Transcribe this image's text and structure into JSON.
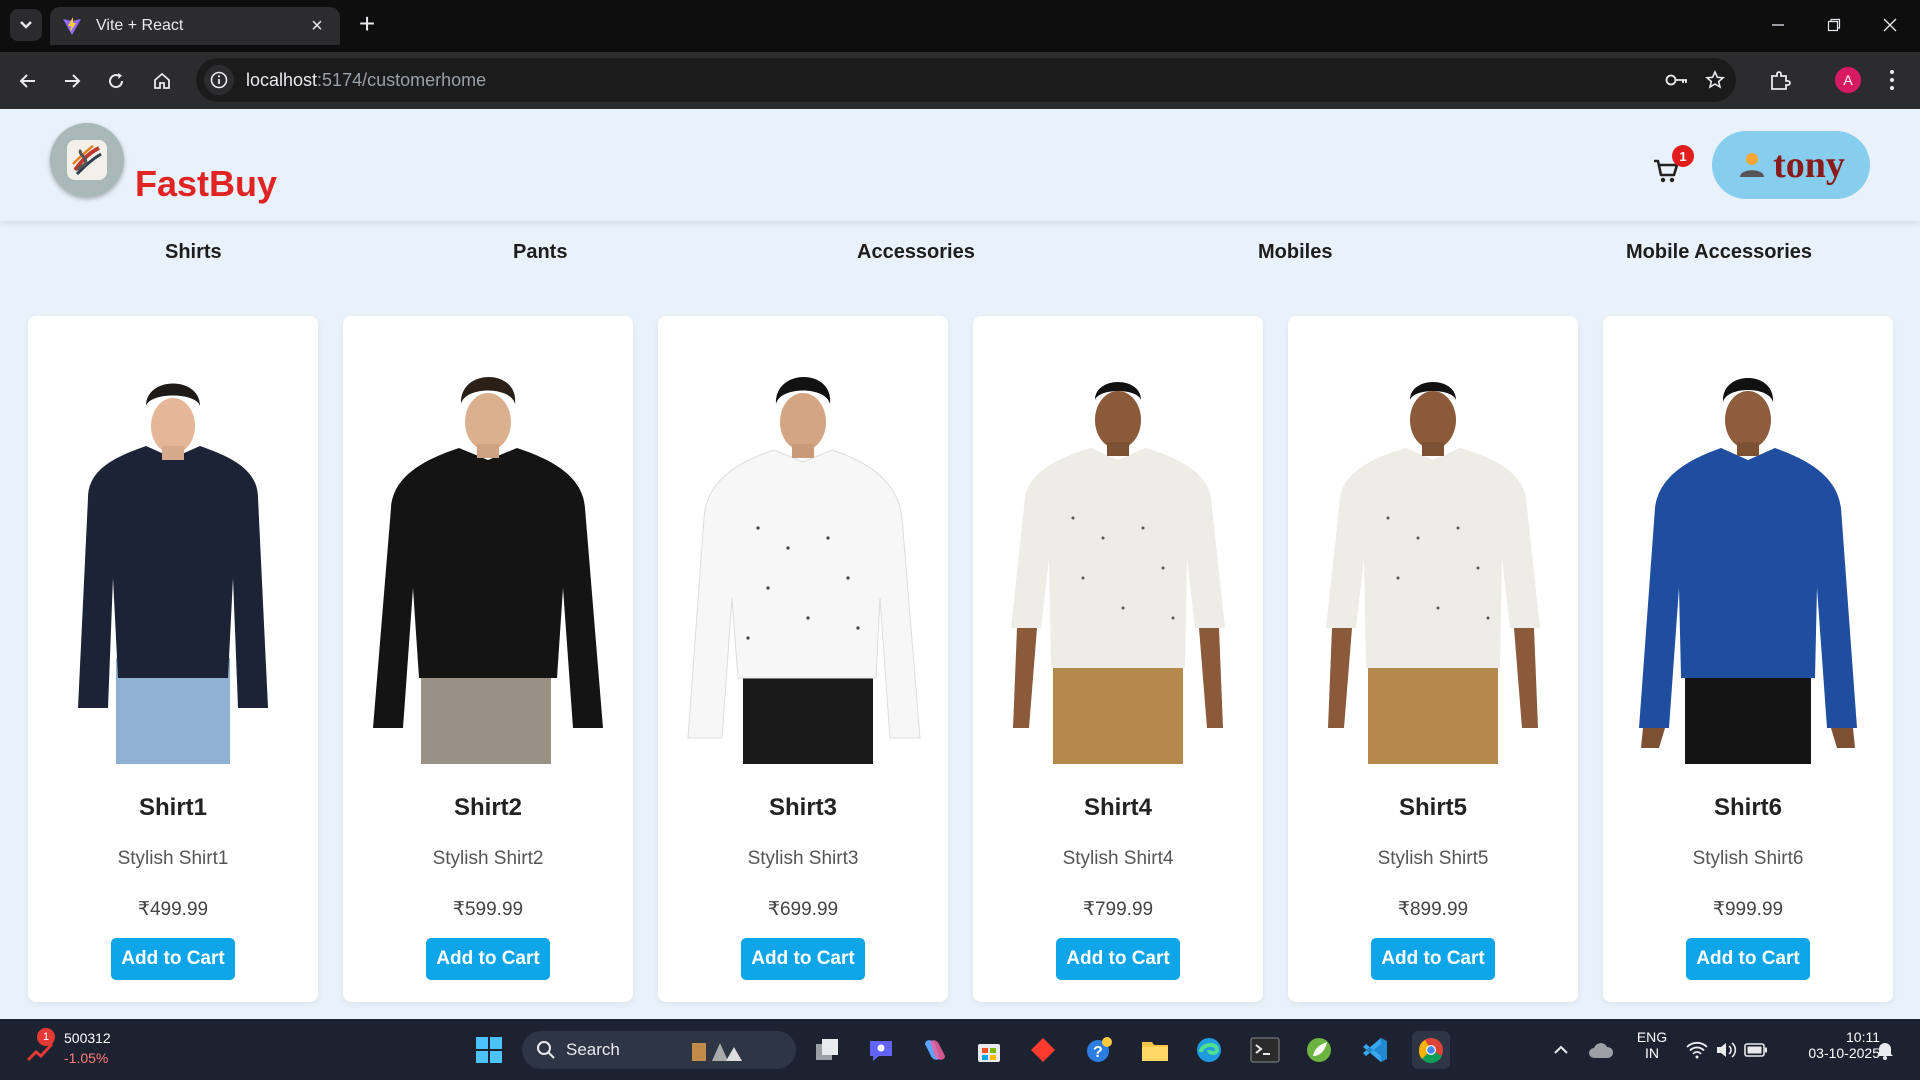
{
  "browser": {
    "tab_title": "Vite + React",
    "new_tab_label": "+",
    "tab_close_label": "×",
    "url_host": "localhost",
    "url_path": ":5174/customerhome",
    "profile_initial": "A"
  },
  "site": {
    "brand": "FastBuy",
    "cart_count": "1",
    "user_name": "tony",
    "brand_color": "#e02424",
    "accent_color": "#0ea5e9"
  },
  "categories": [
    "Shirts",
    "Pants",
    "Accessories",
    "Mobiles",
    "Mobile Accessories"
  ],
  "products": [
    {
      "name": "Shirt1",
      "description": "Stylish Shirt1",
      "price": "₹499.99",
      "button": "Add to Cart",
      "shirt_color": "#1d2336",
      "pants_color": "#8fb2d4"
    },
    {
      "name": "Shirt2",
      "description": "Stylish Shirt2",
      "price": "₹599.99",
      "button": "Add to Cart",
      "shirt_color": "#141414",
      "pants_color": "#9a9185"
    },
    {
      "name": "Shirt3",
      "description": "Stylish Shirt3",
      "price": "₹699.99",
      "button": "Add to Cart",
      "shirt_color": "#f7f7f7",
      "pants_color": "#1a1a1a"
    },
    {
      "name": "Shirt4",
      "description": "Stylish Shirt4",
      "price": "₹799.99",
      "button": "Add to Cart",
      "shirt_color": "#eeece6",
      "pants_color": "#b5884b"
    },
    {
      "name": "Shirt5",
      "description": "Stylish Shirt5",
      "price": "₹899.99",
      "button": "Add to Cart",
      "shirt_color": "#eeece6",
      "pants_color": "#b5884b"
    },
    {
      "name": "Shirt6",
      "description": "Stylish Shirt6",
      "price": "₹999.99",
      "button": "Add to Cart",
      "shirt_color": "#1f4ea0",
      "pants_color": "#141414"
    }
  ],
  "taskbar": {
    "stock_value": "500312",
    "stock_change": "-1.05%",
    "stock_badge": "1",
    "search_label": "Search",
    "lang_top": "ENG",
    "lang_bottom": "IN",
    "time": "10:11",
    "date": "03-10-2025"
  }
}
